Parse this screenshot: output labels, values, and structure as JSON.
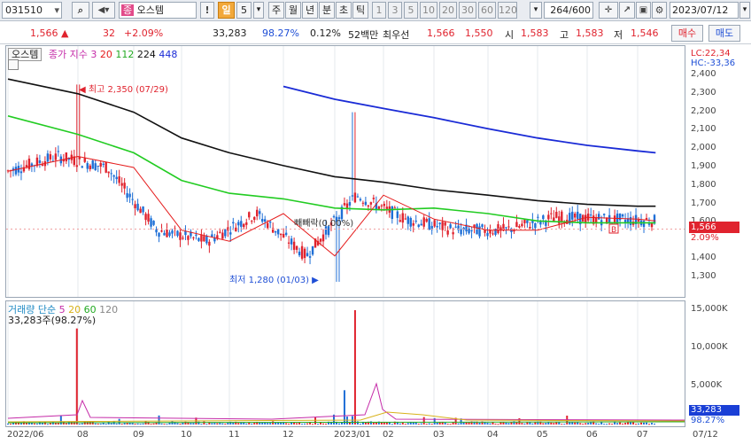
{
  "toolbar": {
    "code": "031510",
    "name_badge": "종",
    "name": "오스템",
    "period_label": "일",
    "period_value": "5",
    "periods": [
      "주",
      "월",
      "년",
      "분",
      "초",
      "틱"
    ],
    "intervals": [
      "1",
      "3",
      "5",
      "10",
      "20",
      "30",
      "60",
      "120"
    ],
    "count": "264",
    "count_total": "/600",
    "date": "2023/07/12"
  },
  "quote": {
    "price": "1,566",
    "change_arrow": "▲",
    "change": "32",
    "change_pct": "+2.09%",
    "volume": "33,283",
    "volume_ratio": "98.27%",
    "turnover": "0.12%",
    "info_label": "52백만",
    "bid_label": "최우선",
    "ask_price": "1,566",
    "bid_price": "1,550",
    "open_label": "시",
    "open": "1,583",
    "high_label": "고",
    "high": "1,583",
    "low_label": "저",
    "low": "1,546",
    "buy_label": "매수",
    "sell_label": "매도"
  },
  "price_panel": {
    "title": "오스템",
    "legend_label": "종가 지수",
    "ma_periods": [
      "3",
      "20",
      "112",
      "224",
      "448"
    ],
    "lc": "LC:22,34",
    "hc": "HC:-33,36",
    "y_ticks": [
      "2,400",
      "2,300",
      "2,200",
      "2,100",
      "2,000",
      "1,900",
      "1,800",
      "1,700",
      "1,600",
      "1,400",
      "1,300"
    ],
    "current_price": "1,566",
    "current_pct": "2.09%",
    "annot_high": "최고 2,350 (07/29)",
    "annot_low": "최저 1,280 (01/03)",
    "annot_mid": "빼빼락(0.00%)",
    "box_b": "B"
  },
  "volume_panel": {
    "legend_label": "거래량 단순",
    "ma_periods": [
      "5",
      "20",
      "60",
      "120"
    ],
    "current_text": "33,283주(98.27%)",
    "y_ticks": [
      "15,000K",
      "10,000K",
      "5,000K"
    ],
    "current_value": "33,283",
    "current_pct": "98.27%"
  },
  "x_ticks": [
    "2022/06",
    "08",
    "09",
    "10",
    "11",
    "12",
    "2023/01",
    "02",
    "03",
    "04",
    "05",
    "06",
    "07",
    "07/12"
  ],
  "colors": {
    "up": "#e0232e",
    "down": "#1f6fd6",
    "ma3": "#d8262e",
    "ma20": "#e51b1b",
    "ma112": "#22cc22",
    "ma224": "#111111",
    "ma448": "#1a2bd6"
  },
  "chart_data": {
    "type": "line",
    "title": "오스템",
    "xlabel": "",
    "ylabel": "",
    "ylim": [
      1250,
      2450
    ],
    "x": [
      "2022/06",
      "08",
      "09",
      "10",
      "11",
      "12",
      "2023/01",
      "02",
      "03",
      "04",
      "05",
      "06",
      "07",
      "07/12"
    ],
    "series": [
      {
        "name": "224",
        "values": [
          2380,
          2300,
          2200,
          2060,
          1980,
          1910,
          1850,
          1820,
          1780,
          1750,
          1720,
          1700,
          1690,
          1690
        ]
      },
      {
        "name": "448",
        "values": [
          null,
          null,
          null,
          null,
          null,
          2340,
          2270,
          2220,
          2170,
          2110,
          2060,
          2020,
          1990,
          1980
        ]
      },
      {
        "name": "112",
        "values": [
          2180,
          2080,
          1980,
          1830,
          1760,
          1730,
          1680,
          1670,
          1680,
          1650,
          1610,
          1600,
          1600,
          1600
        ]
      },
      {
        "name": "20",
        "values": [
          1880,
          1960,
          1900,
          1560,
          1500,
          1650,
          1420,
          1750,
          1620,
          1560,
          1560,
          1630,
          1620,
          1610
        ]
      }
    ],
    "annotations": [
      "최고 2,350 (07/29)",
      "최저 1,280 (01/03)"
    ]
  }
}
